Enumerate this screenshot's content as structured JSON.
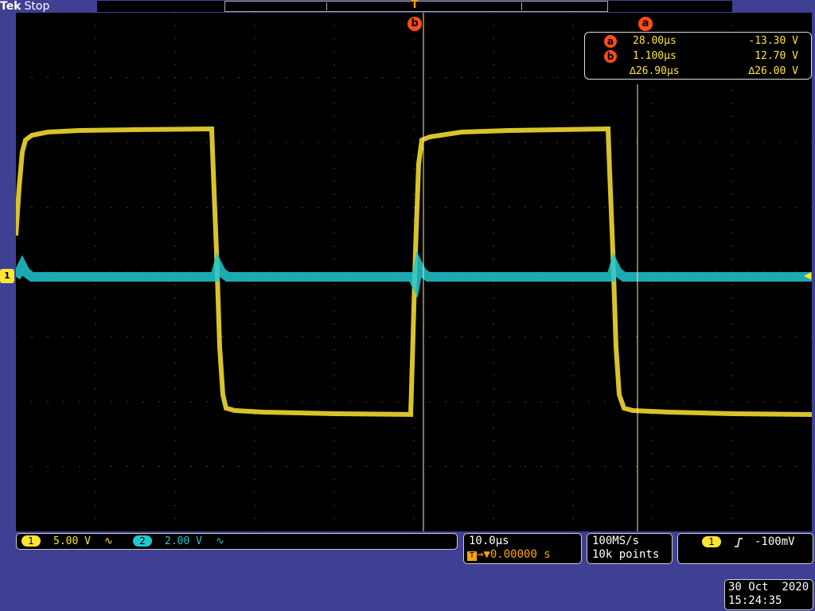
{
  "header": {
    "brand": "Tek",
    "run_state": "Stop"
  },
  "cursors": {
    "a_label": "a",
    "b_label": "b",
    "readout": {
      "a": {
        "label": "a",
        "time": "28.00µs",
        "voltage": "-13.30 V"
      },
      "b": {
        "label": "b",
        "time": "1.100µs",
        "voltage": "12.70 V"
      },
      "delta": {
        "time": "∆26.90µs",
        "voltage": "∆26.00 V"
      }
    }
  },
  "markers": {
    "ch1": "1",
    "ch2": "2",
    "trigger_top": "T"
  },
  "channels": [
    {
      "num": "1",
      "scale": "5.00 V",
      "coupling": "∿",
      "color": "#ffe533"
    },
    {
      "num": "2",
      "scale": "2.00 V",
      "coupling": "∿",
      "color": "#20c8d0"
    }
  ],
  "timebase": {
    "scale": "10.0µs",
    "position": "0.00000 s",
    "trig_icon": "T"
  },
  "acquisition": {
    "rate": "100MS/s",
    "length": "10k points"
  },
  "trigger": {
    "channel": "1",
    "slope_icon": "rising-edge-icon",
    "level": "-100mV"
  },
  "datetime": {
    "date": "30 Oct  2020",
    "time": "15:24:35"
  },
  "colors": {
    "ch1": "#ffe533",
    "ch2": "#20c8d0",
    "cursor": "#ff4b1a",
    "frame": "#3f3f93"
  }
}
